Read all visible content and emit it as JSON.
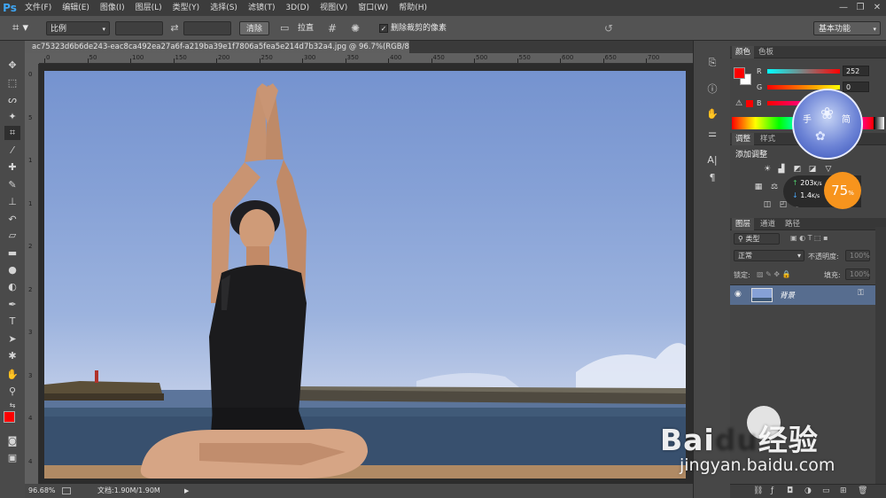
{
  "menubar": {
    "logo": "Ps",
    "items": [
      "文件(F)",
      "编辑(E)",
      "图像(I)",
      "图层(L)",
      "类型(Y)",
      "选择(S)",
      "滤镜(T)",
      "3D(D)",
      "视图(V)",
      "窗口(W)",
      "帮助(H)"
    ]
  },
  "options": {
    "ratio_value": "比例",
    "clear_label": "清除",
    "straighten_label": "拉直",
    "delete_cropped_label": "删除裁剪的像素",
    "delete_cropped_checked": true,
    "workspace_value": "基本功能"
  },
  "document": {
    "tab_title": "ac75323d6b6de243-eac8ca492ea27a6f-a219ba39e1f7806a5fea5e214d7b32a4.jpg @ 96.7%(RGB/8#) *",
    "close_glyph": "×",
    "zoom": "96.68%",
    "doc_info": "文档:1.90M/1.90M",
    "ruler_top_ticks": [
      "0",
      "50",
      "100",
      "150",
      "200",
      "250",
      "300",
      "350",
      "400",
      "450",
      "500",
      "550",
      "600",
      "650",
      "700"
    ],
    "ruler_left_ticks": [
      "0",
      "5",
      "1",
      "1",
      "2",
      "2",
      "3",
      "3",
      "4",
      "4"
    ]
  },
  "color_panel": {
    "tabs": [
      "颜色",
      "色板"
    ],
    "channels": [
      {
        "label": "R",
        "value": "252",
        "gradient_start": "#00ffff",
        "gradient_end": "#ff0000"
      },
      {
        "label": "G",
        "value": "0",
        "gradient_start": "#fc0000",
        "gradient_end": "#fcff00"
      },
      {
        "label": "B",
        "value": "",
        "gradient_start": "#fc0000",
        "gradient_end": "#fc00ff"
      }
    ],
    "foreground_color": "#fc0000",
    "background_color": "#ffffff"
  },
  "adjustments_panel": {
    "tabs": [
      "调整",
      "样式"
    ],
    "title": "添加调整"
  },
  "net_widget": {
    "up_speed": "203",
    "up_unit": "K/s",
    "down_speed": "1.4",
    "down_unit": "K/s",
    "percent": "75",
    "percent_sign": "%"
  },
  "clock_widget": {
    "chars": [
      "手",
      "简"
    ]
  },
  "layers_panel": {
    "tabs": [
      "图层",
      "通道",
      "路径"
    ],
    "filter_label": "类型",
    "blend_mode": "正常",
    "opacity_label": "不透明度:",
    "opacity_value": "100%",
    "lock_label": "锁定:",
    "fill_label": "填充:",
    "fill_value": "100%",
    "layers": [
      {
        "name": "背景",
        "visible": true,
        "locked": true
      }
    ]
  },
  "watermark": {
    "brand_prefix": "Bai",
    "brand_suffix": "经验",
    "url": "jingyan.baidu.com"
  },
  "colors": {
    "accent_blue": "#3fa6f4",
    "selected_layer": "#576d8f",
    "foreground": "#fc0000",
    "speed_orange": "#f7941d"
  }
}
